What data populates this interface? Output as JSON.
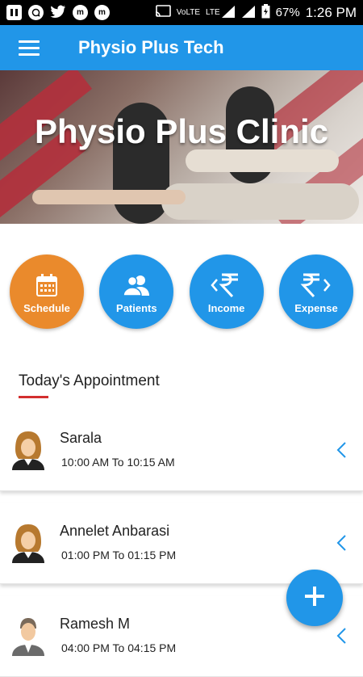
{
  "status_bar": {
    "carrier_tag": "VoLTE",
    "lte_tag": "LTE",
    "battery": "67%",
    "time": "1:26 PM",
    "icons": [
      "pause-icon",
      "whatsapp-icon",
      "twitter-icon",
      "messenger-icon",
      "messenger-icon",
      "cast-icon",
      "signal-icon",
      "signal-icon",
      "battery-icon"
    ]
  },
  "app_bar": {
    "title": "Physio Plus Tech",
    "menu_icon": "hamburger-menu-icon"
  },
  "hero": {
    "title": "Physio Plus Clinic"
  },
  "quick_actions": [
    {
      "label": "Schedule",
      "icon": "calendar-icon",
      "color": "#ea8a2c"
    },
    {
      "label": "Patients",
      "icon": "users-icon",
      "color": "#2196e8"
    },
    {
      "label": "Income",
      "icon": "rupee-in-icon",
      "color": "#2196e8"
    },
    {
      "label": "Expense",
      "icon": "rupee-out-icon",
      "color": "#2196e8"
    }
  ],
  "appointments_section": {
    "title": "Today's Appointment",
    "accent": "#d32f2f"
  },
  "appointments": [
    {
      "name": "Sarala",
      "time": "10:00 AM To 10:15 AM",
      "avatar": "female-avatar-icon"
    },
    {
      "name": "Annelet Anbarasi",
      "time": "01:00 PM To 01:15 PM",
      "avatar": "female-avatar-icon"
    },
    {
      "name": "Ramesh M",
      "time": "04:00 PM To 04:15 PM",
      "avatar": "male-avatar-icon"
    }
  ],
  "fab": {
    "icon": "plus-icon"
  },
  "colors": {
    "primary": "#2196e8",
    "orange": "#ea8a2c",
    "accent_red": "#d32f2f"
  }
}
